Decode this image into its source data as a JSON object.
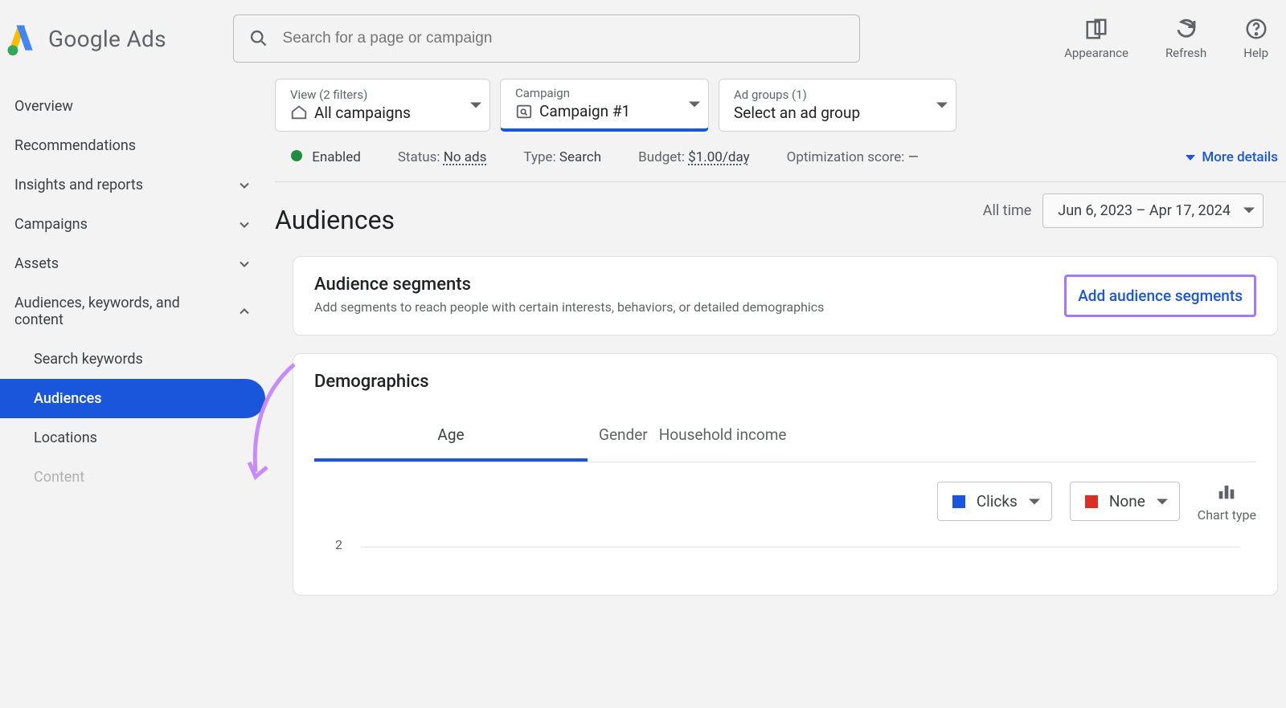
{
  "brand": {
    "google": "Google",
    "ads": "Ads"
  },
  "search": {
    "placeholder": "Search for a page or campaign"
  },
  "header_actions": {
    "appearance": "Appearance",
    "refresh": "Refresh",
    "help": "Help"
  },
  "sidebar": {
    "overview": "Overview",
    "recommendations": "Recommendations",
    "insights": "Insights and reports",
    "campaigns": "Campaigns",
    "assets": "Assets",
    "audiences_kw_content": "Audiences, keywords, and content",
    "search_keywords": "Search keywords",
    "audiences": "Audiences",
    "locations": "Locations",
    "content": "Content"
  },
  "scope": {
    "view_label": "View (2 filters)",
    "view_value": "All campaigns",
    "campaign_label": "Campaign",
    "campaign_value": "Campaign #1",
    "adgroup_label": "Ad groups (1)",
    "adgroup_value": "Select an ad group"
  },
  "status_row": {
    "enabled": "Enabled",
    "status_label": "Status: ",
    "status_value": "No ads",
    "type_label": "Type: ",
    "type_value": "Search",
    "budget_label": "Budget: ",
    "budget_value": "$1.00/day",
    "opt_label": "Optimization score: ",
    "opt_value": "—",
    "more": "More details"
  },
  "title": "Audiences",
  "time": {
    "all_time": "All time",
    "range": "Jun 6, 2023 – Apr 17, 2024"
  },
  "segments_card": {
    "title": "Audience segments",
    "sub": "Add segments to reach people with certain interests, behaviors, or detailed demographics",
    "cta": "Add audience segments"
  },
  "demographics": {
    "title": "Demographics",
    "tabs": {
      "age": "Age",
      "gender": "Gender",
      "income": "Household income"
    },
    "metric1": "Clicks",
    "metric2": "None",
    "chart_type": "Chart type",
    "ylabel": "2"
  },
  "chart_data": {
    "type": "bar",
    "categories": [],
    "series": [
      {
        "name": "Clicks",
        "color": "#1a56db",
        "values": []
      },
      {
        "name": "None",
        "color": "#d93025",
        "values": []
      }
    ],
    "ylabel": "",
    "ylim": [
      0,
      2
    ]
  }
}
